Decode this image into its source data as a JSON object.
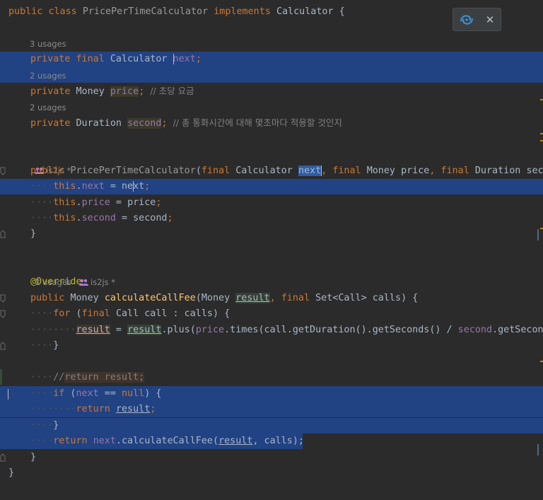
{
  "editor": {
    "language": "Java",
    "class_decl": {
      "public": "public",
      "class": "class",
      "name": "PricePerTimeCalculator",
      "implements": "implements",
      "iface": "Calculator",
      "brace": " {"
    },
    "fields": [
      {
        "usages": "3 usages",
        "private": "private",
        "final": "final",
        "type": "Calculator",
        "name": "next",
        "end": ";"
      },
      {
        "usages": "2 usages",
        "private": "private",
        "type": "Money",
        "name": "price",
        "end": ";",
        "comment": "// 초당 요금"
      },
      {
        "usages": "2 usages",
        "private": "private",
        "type": "Duration",
        "name": "second",
        "end": ";",
        "comment": "// 총 통화시간에 대해 몇초마다 적용할 것인지"
      }
    ],
    "constructor": {
      "author": "is2js *",
      "public": "public",
      "name": "PricePerTimeCalculator",
      "open_paren": "(",
      "final": "final",
      "p1_type": "Calculator",
      "p1": "next",
      "comma": ",",
      "p2_type": "Money",
      "p2": "price",
      "p3_type": "Duration",
      "p3": "seco",
      "this": "this",
      "dot": ".",
      "f_next": "next",
      "f_price": "price",
      "f_second": "second",
      "eq": " = ",
      "rhs_next_a": "ne",
      "rhs_next_b": "xt",
      "rhs_price": "price",
      "rhs_second": "second",
      "semi": ";",
      "close": "}"
    },
    "method": {
      "usages": "2 usages",
      "author": "is2js *",
      "annotation": "@Override",
      "public": "public",
      "return_type": "Money",
      "name": "calculateCallFee",
      "open": "(",
      "p1_type": "Money",
      "p1": "result",
      "comma": ", ",
      "final": "final",
      "p2_type": "Set<Call>",
      "p2": "calls",
      "sig_end": ") {",
      "for": "for",
      "for_open": " (",
      "for_type": "Call",
      "for_var": "call",
      "for_rest": " : calls) {",
      "assign_lhs": "result",
      "assign_eq": " = ",
      "assign_rhs": "result",
      "assign_call_a": ".plus(",
      "assign_price": "price",
      "assign_call_b": ".times(call.getDuration().getSeconds() / ",
      "assign_second": "second",
      "assign_call_c": ".getSecond",
      "for_close": "}",
      "comment_slashes": "//",
      "comment_body": "return result;",
      "if": "if",
      "if_open": " (",
      "if_next": "next",
      "if_op": " == ",
      "null": "null",
      "if_end": ") {",
      "return": "return",
      "ret_result": "result",
      "ret_semi": ";",
      "if_close": "}",
      "ret2_next": "next",
      "ret2_call": ".calculateCallFee(",
      "ret2_result": "result",
      "ret2_rest": ", calls);",
      "method_close": "}"
    },
    "class_close": "}"
  },
  "popup": {
    "icon": "ai-assistant-icon",
    "close": "✕"
  },
  "colors": {
    "background": "#2b2b2b",
    "selection": "#214283",
    "keyword": "#cc7832",
    "field": "#9876aa",
    "method": "#ffc66d",
    "comment": "#808080",
    "annotation": "#bbb529"
  }
}
